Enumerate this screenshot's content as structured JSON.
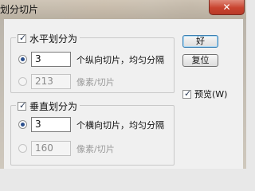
{
  "dialog": {
    "title": "划分切片",
    "close_icon_glyph": "✕"
  },
  "horizontal": {
    "label": "水平划分为",
    "checked": true,
    "count_value": "3",
    "count_suffix": "个纵向切片，均匀分隔",
    "pixel_value": "213",
    "pixel_suffix": "像素/切片"
  },
  "vertical": {
    "label": "垂直划分为",
    "checked": true,
    "count_value": "3",
    "count_suffix": "个横向切片，均匀分隔",
    "pixel_value": "160",
    "pixel_suffix": "像素/切片"
  },
  "buttons": {
    "ok_label": "好",
    "reset_label": "复位"
  },
  "preview": {
    "label": "预览(W)",
    "checked": true
  }
}
